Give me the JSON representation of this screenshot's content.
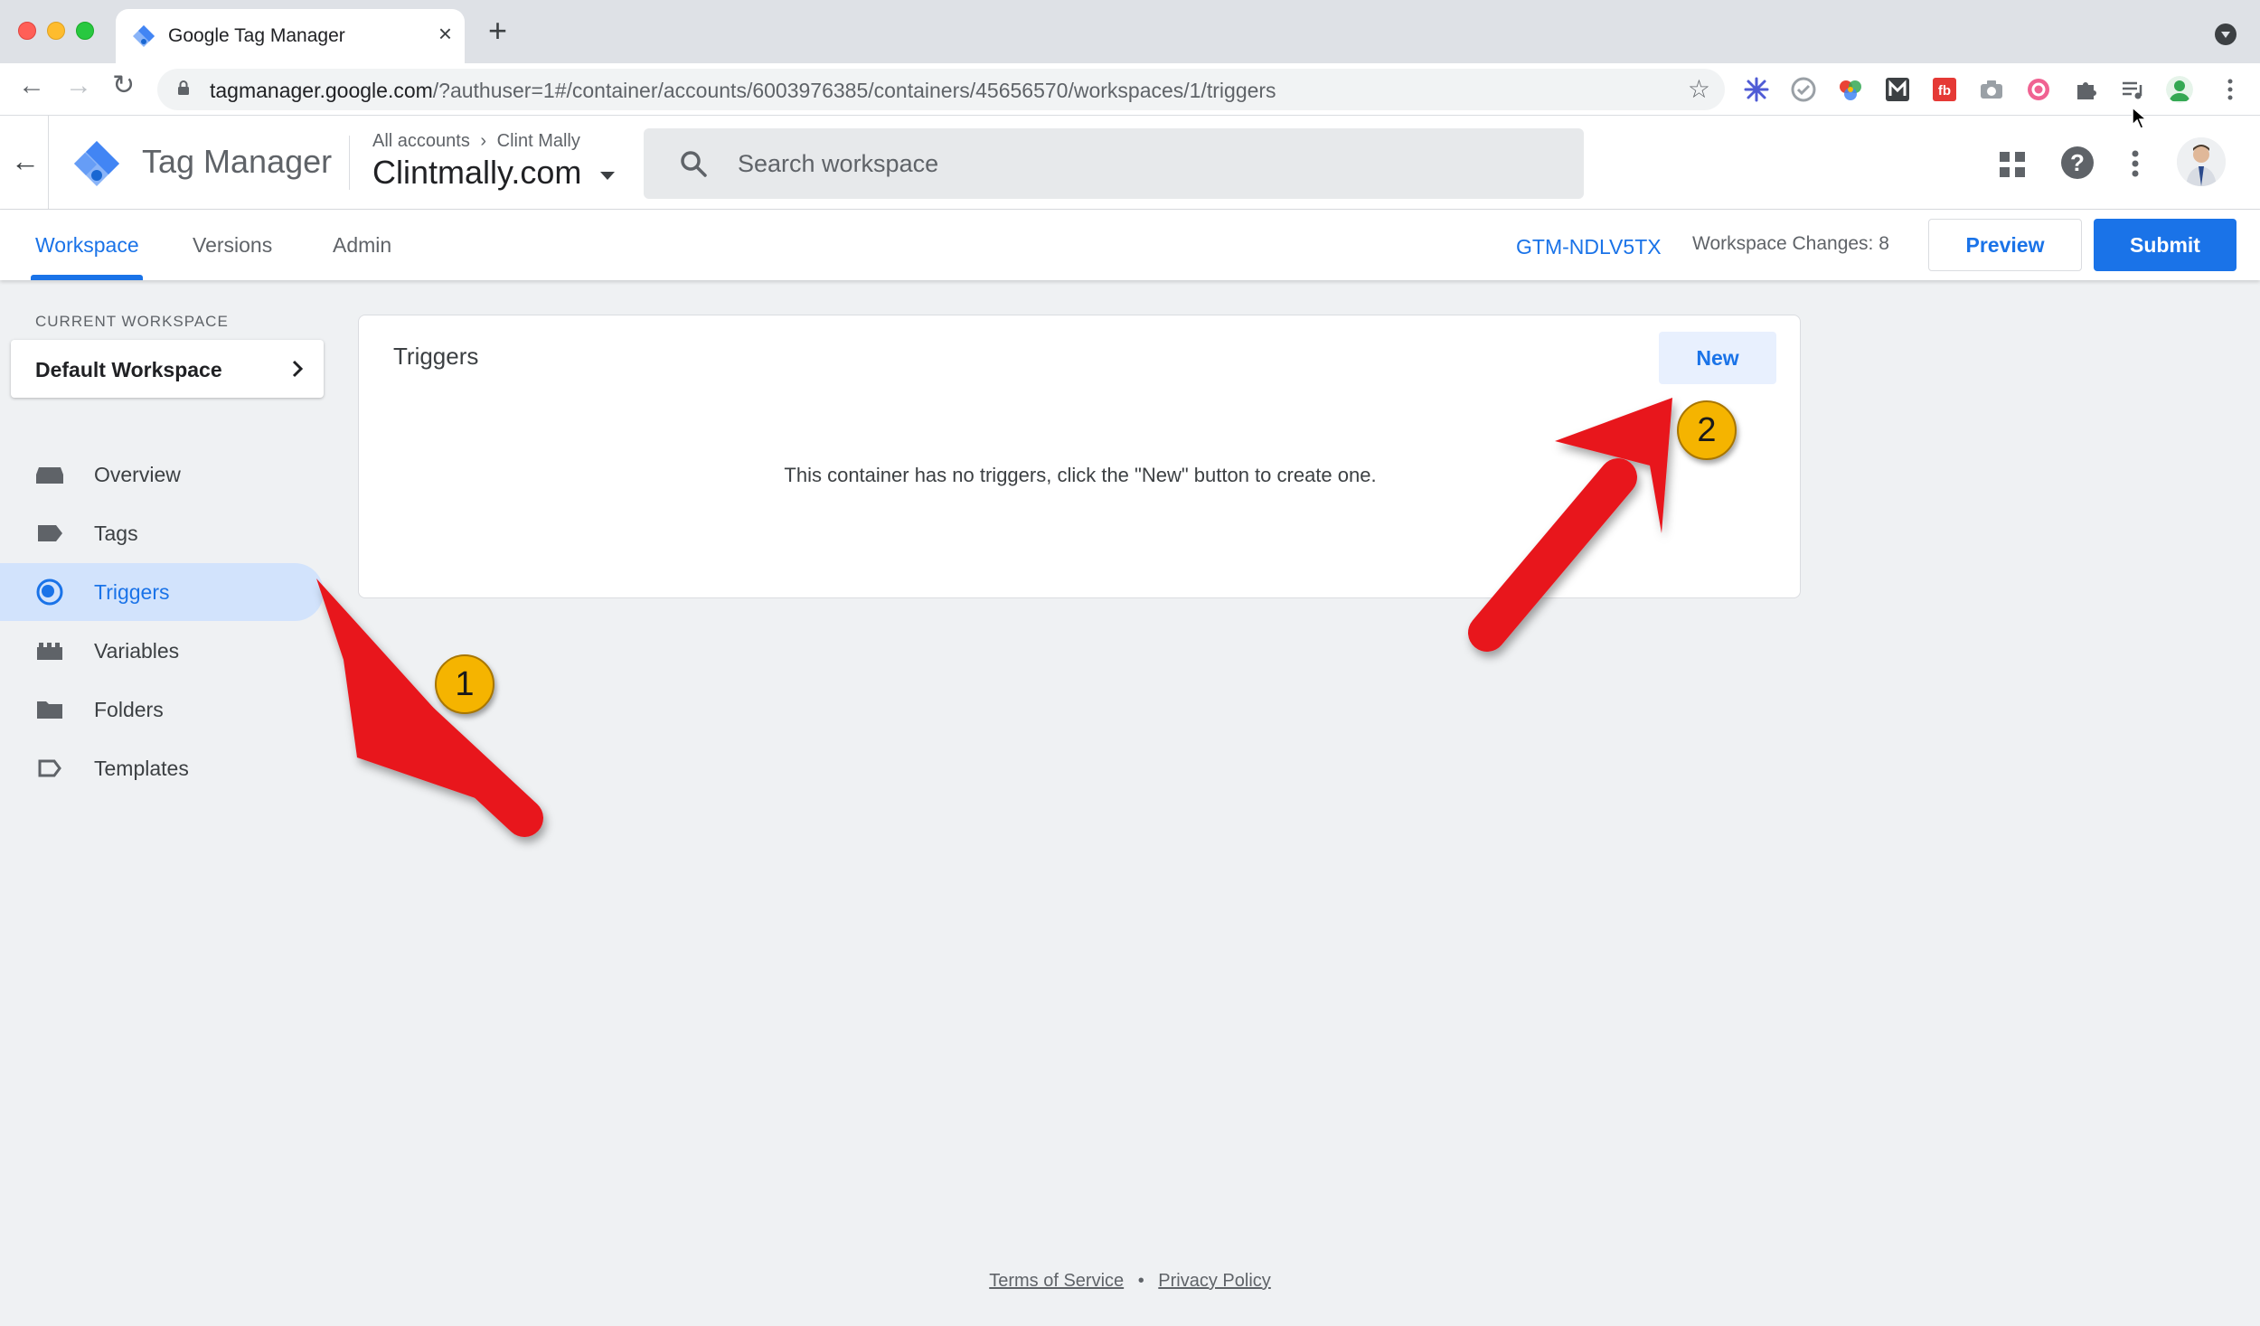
{
  "browser": {
    "tab_title": "Google Tag Manager",
    "tab_close": "×",
    "new_tab": "+",
    "url_host": "tagmanager.google.com",
    "url_path": "/?authuser=1#/container/accounts/6003976385/containers/45656570/workspaces/1/triggers",
    "nav_back": "←",
    "nav_forward": "→",
    "nav_reload": "↻",
    "bookmark_star": "☆"
  },
  "header": {
    "back_arrow": "←",
    "product_name": "Tag Manager",
    "breadcrumb_root": "All accounts",
    "breadcrumb_sep": "›",
    "breadcrumb_account": "Clint Mally",
    "container_name": "Clintmally.com",
    "search_placeholder": "Search workspace",
    "help_glyph": "?"
  },
  "subnav": {
    "tabs": [
      {
        "label": "Workspace",
        "active": true
      },
      {
        "label": "Versions",
        "active": false
      },
      {
        "label": "Admin",
        "active": false
      }
    ],
    "container_id": "GTM-NDLV5TX",
    "workspace_changes": "Workspace Changes: 8",
    "preview_label": "Preview",
    "submit_label": "Submit"
  },
  "sidebar": {
    "current_workspace_label": "CURRENT WORKSPACE",
    "workspace_name": "Default Workspace",
    "items": [
      {
        "label": "Overview",
        "icon": "overview-icon",
        "active": false
      },
      {
        "label": "Tags",
        "icon": "tag-icon",
        "active": false
      },
      {
        "label": "Triggers",
        "icon": "trigger-icon",
        "active": true
      },
      {
        "label": "Variables",
        "icon": "variables-icon",
        "active": false
      },
      {
        "label": "Folders",
        "icon": "folder-icon",
        "active": false
      },
      {
        "label": "Templates",
        "icon": "template-icon",
        "active": false
      }
    ]
  },
  "main": {
    "card_title": "Triggers",
    "new_button": "New",
    "empty_message": "This container has no triggers, click the \"New\" button to create one."
  },
  "footer": {
    "terms": "Terms of Service",
    "separator": "•",
    "privacy": "Privacy Policy"
  },
  "annotations": {
    "badge_1": "1",
    "badge_2": "2",
    "arrow_color": "#e8151f",
    "badge_color": "#f5b400"
  },
  "colors": {
    "accent": "#1a73e8",
    "active_nav_bg": "#d2e3fc",
    "page_bg": "#eff1f3"
  }
}
